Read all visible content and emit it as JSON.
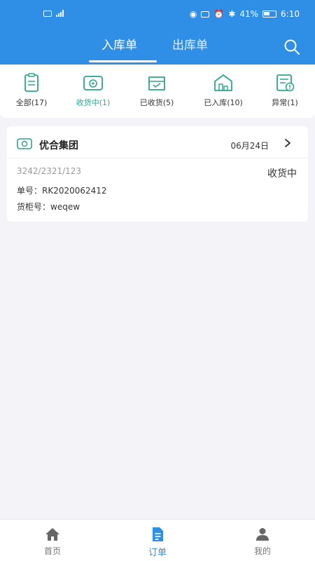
{
  "colors": {
    "primary": "#2f8ee6",
    "accent": "#2aa58e",
    "background": "#f4f4f8"
  },
  "status_bar": {
    "battery": "41%",
    "time": "6:10"
  },
  "header": {
    "tabs": [
      {
        "label": "入库单",
        "active": true
      },
      {
        "label": "出库单",
        "active": false
      }
    ],
    "search_icon": "search-icon"
  },
  "filters": [
    {
      "label": "全部(17)",
      "icon": "clipboard-icon",
      "active": false
    },
    {
      "label": "收货中(1)",
      "icon": "receiving-icon",
      "active": true
    },
    {
      "label": "已收货(5)",
      "icon": "inbox-check-icon",
      "active": false
    },
    {
      "label": "已入库(10)",
      "icon": "warehouse-icon",
      "active": false
    },
    {
      "label": "异常(1)",
      "icon": "exception-icon",
      "active": false
    }
  ],
  "orders": [
    {
      "company": "优合集团",
      "date": "06月24日",
      "code": "3242/2321/123",
      "status": "收货中",
      "order_no_label": "单号：",
      "order_no": "RK2020062412",
      "container_label": "货柜号：",
      "container": "weqew"
    }
  ],
  "bottom_nav": [
    {
      "label": "首页",
      "icon": "home-icon",
      "active": false
    },
    {
      "label": "订单",
      "icon": "order-icon",
      "active": true
    },
    {
      "label": "我的",
      "icon": "user-icon",
      "active": false
    }
  ]
}
